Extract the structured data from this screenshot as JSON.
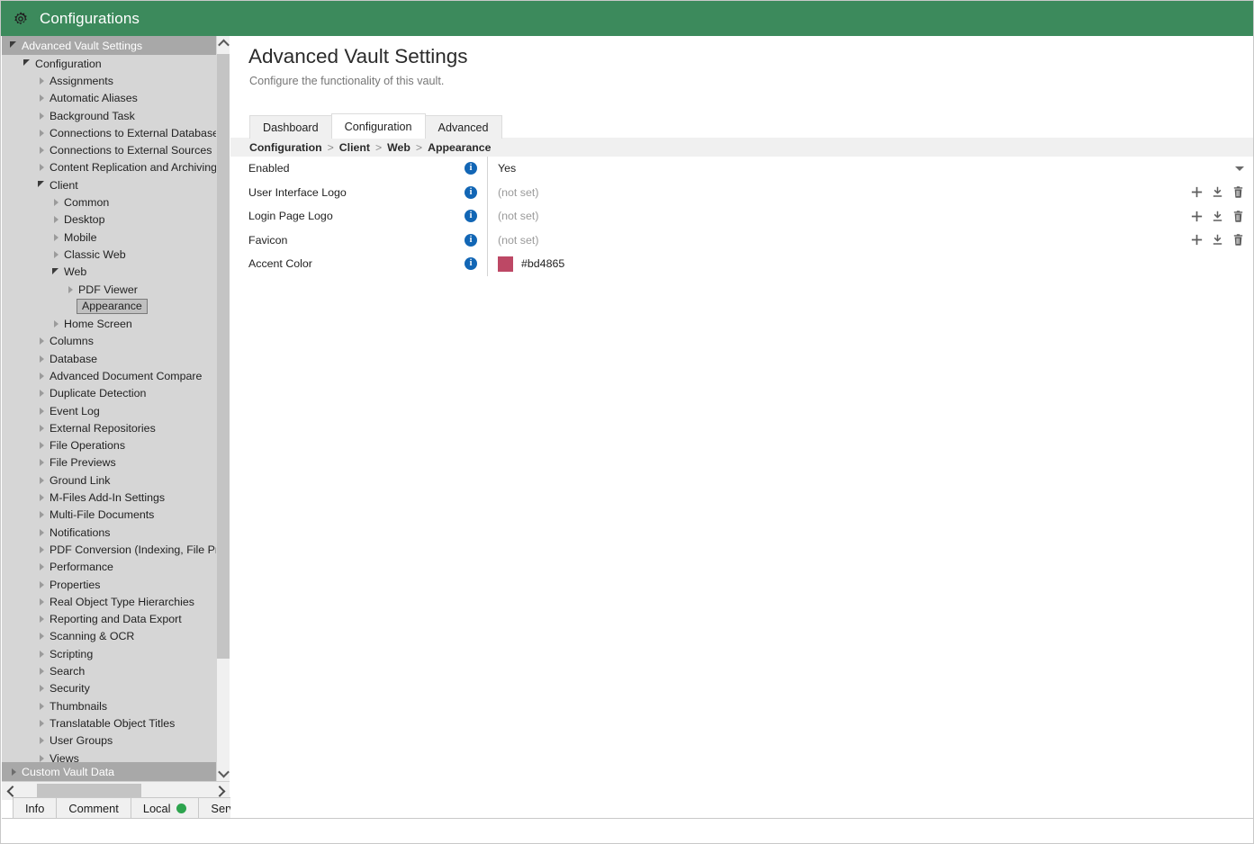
{
  "window": {
    "title": "Configurations",
    "icon": "gear-icon",
    "titlebar_color": "#3c8a5c"
  },
  "sidebar": {
    "root": {
      "label": "Advanced Vault Settings",
      "expanded": true
    },
    "bottom_root": {
      "label": "Custom Vault Data",
      "expanded": false
    },
    "items": [
      {
        "label": "Configuration",
        "level": 1,
        "state": "expanded"
      },
      {
        "label": "Assignments",
        "level": 2,
        "state": "collapsed"
      },
      {
        "label": "Automatic Aliases",
        "level": 2,
        "state": "collapsed"
      },
      {
        "label": "Background Task",
        "level": 2,
        "state": "collapsed"
      },
      {
        "label": "Connections to External Database",
        "level": 2,
        "state": "collapsed"
      },
      {
        "label": "Connections to External Sources",
        "level": 2,
        "state": "collapsed"
      },
      {
        "label": "Content Replication and Archiving",
        "level": 2,
        "state": "collapsed"
      },
      {
        "label": "Client",
        "level": 2,
        "state": "expanded"
      },
      {
        "label": "Common",
        "level": 3,
        "state": "collapsed"
      },
      {
        "label": "Desktop",
        "level": 3,
        "state": "collapsed"
      },
      {
        "label": "Mobile",
        "level": 3,
        "state": "collapsed"
      },
      {
        "label": "Classic Web",
        "level": 3,
        "state": "collapsed"
      },
      {
        "label": "Web",
        "level": 3,
        "state": "expanded"
      },
      {
        "label": "PDF Viewer",
        "level": 4,
        "state": "collapsed"
      },
      {
        "label": "Appearance",
        "level": 4,
        "state": "leaf",
        "selected": true
      },
      {
        "label": "Home Screen",
        "level": 3,
        "state": "collapsed"
      },
      {
        "label": "Columns",
        "level": 2,
        "state": "collapsed"
      },
      {
        "label": "Database",
        "level": 2,
        "state": "collapsed"
      },
      {
        "label": "Advanced Document Compare",
        "level": 2,
        "state": "collapsed"
      },
      {
        "label": "Duplicate Detection",
        "level": 2,
        "state": "collapsed"
      },
      {
        "label": "Event Log",
        "level": 2,
        "state": "collapsed"
      },
      {
        "label": "External Repositories",
        "level": 2,
        "state": "collapsed"
      },
      {
        "label": "File Operations",
        "level": 2,
        "state": "collapsed"
      },
      {
        "label": "File Previews",
        "level": 2,
        "state": "collapsed"
      },
      {
        "label": "Ground Link",
        "level": 2,
        "state": "collapsed"
      },
      {
        "label": "M-Files Add-In Settings",
        "level": 2,
        "state": "collapsed"
      },
      {
        "label": "Multi-File Documents",
        "level": 2,
        "state": "collapsed"
      },
      {
        "label": "Notifications",
        "level": 2,
        "state": "collapsed"
      },
      {
        "label": "PDF Conversion (Indexing, File Previews)",
        "level": 2,
        "state": "collapsed"
      },
      {
        "label": "Performance",
        "level": 2,
        "state": "collapsed"
      },
      {
        "label": "Properties",
        "level": 2,
        "state": "collapsed"
      },
      {
        "label": "Real Object Type Hierarchies",
        "level": 2,
        "state": "collapsed"
      },
      {
        "label": "Reporting and Data Export",
        "level": 2,
        "state": "collapsed"
      },
      {
        "label": "Scanning & OCR",
        "level": 2,
        "state": "collapsed"
      },
      {
        "label": "Scripting",
        "level": 2,
        "state": "collapsed"
      },
      {
        "label": "Search",
        "level": 2,
        "state": "collapsed"
      },
      {
        "label": "Security",
        "level": 2,
        "state": "collapsed"
      },
      {
        "label": "Thumbnails",
        "level": 2,
        "state": "collapsed"
      },
      {
        "label": "Translatable Object Titles",
        "level": 2,
        "state": "collapsed"
      },
      {
        "label": "User Groups",
        "level": 2,
        "state": "collapsed"
      },
      {
        "label": "Views",
        "level": 2,
        "state": "collapsed"
      }
    ]
  },
  "main": {
    "title": "Advanced Vault Settings",
    "subtitle": "Configure the functionality of this vault.",
    "tabs": [
      {
        "label": "Dashboard",
        "active": false
      },
      {
        "label": "Configuration",
        "active": true
      },
      {
        "label": "Advanced",
        "active": false
      }
    ],
    "breadcrumb": [
      "Configuration",
      "Client",
      "Web",
      "Appearance"
    ],
    "breadcrumb_separator": ">",
    "settings": [
      {
        "label": "Enabled",
        "value": "Yes",
        "not_set": false,
        "info": "info-icon",
        "actions": [
          "chevron-down-icon"
        ]
      },
      {
        "label": "User Interface Logo",
        "value": "(not set)",
        "not_set": true,
        "info": "info-icon",
        "actions": [
          "add-icon",
          "download-icon",
          "delete-icon"
        ]
      },
      {
        "label": "Login Page Logo",
        "value": "(not set)",
        "not_set": true,
        "info": "info-icon",
        "actions": [
          "add-icon",
          "download-icon",
          "delete-icon"
        ]
      },
      {
        "label": "Favicon",
        "value": "(not set)",
        "not_set": true,
        "info": "info-icon",
        "actions": [
          "add-icon",
          "download-icon",
          "delete-icon"
        ]
      },
      {
        "label": "Accent Color",
        "value": "#bd4865",
        "not_set": false,
        "swatch_color": "#bd4865",
        "info": "info-icon",
        "actions": []
      }
    ]
  },
  "bottom_tabs": [
    {
      "label": "Info",
      "status": null
    },
    {
      "label": "Comment",
      "status": null
    },
    {
      "label": "Local",
      "status": "#2da44e"
    },
    {
      "label": "Server",
      "status": "#2da44e"
    }
  ]
}
